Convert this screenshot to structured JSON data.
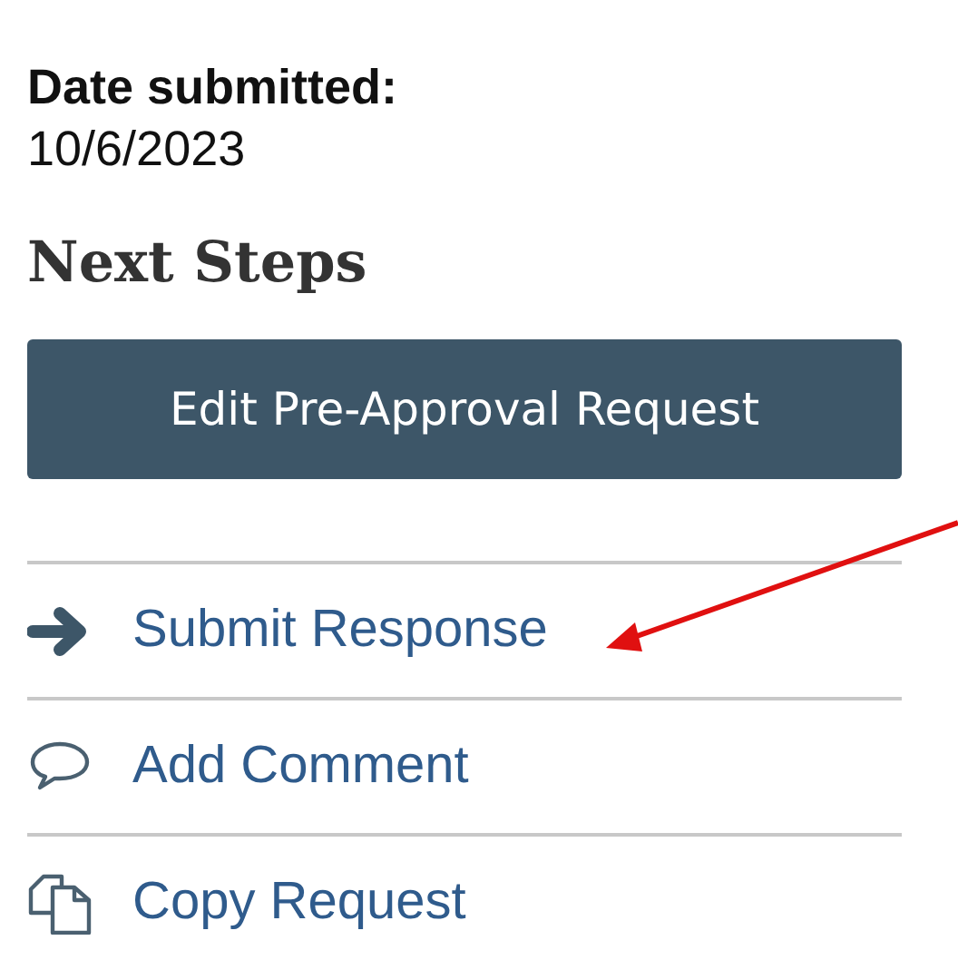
{
  "details": [
    {
      "label": "Date submitted:",
      "value": "10/6/2023"
    }
  ],
  "next_steps": {
    "title": "Next Steps",
    "primary_button": "Edit Pre-Approval Request",
    "actions": [
      {
        "kind": "arrow",
        "label": "Submit Response"
      },
      {
        "kind": "comment",
        "label": "Add Comment"
      },
      {
        "kind": "copy",
        "label": "Copy Request"
      }
    ]
  }
}
